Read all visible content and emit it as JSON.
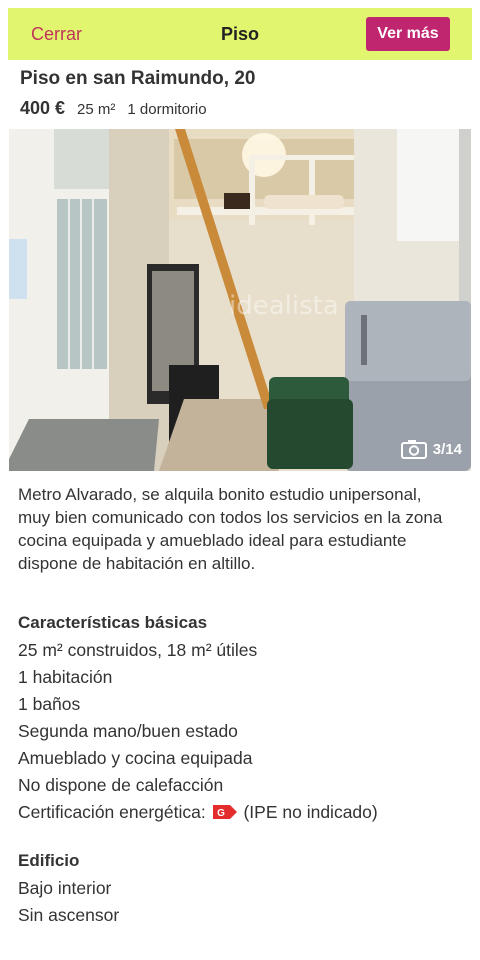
{
  "nav": {
    "close_label": "Cerrar",
    "title": "Piso",
    "more_label": "Ver más"
  },
  "listing": {
    "title": "Piso en san Raimundo, 20",
    "price": "400 €",
    "area": "25 m²",
    "bedrooms": "1 dormitorio"
  },
  "photo": {
    "watermark": "idealista",
    "counter": "3/14",
    "icon": "camera-icon"
  },
  "description": "Metro Alvarado, se alquila bonito estudio unipersonal, muy bien comunicado con todos los servicios en la zona cocina equipada y amueblado ideal para estudiante dispone de habitación en altillo.",
  "basic": {
    "title": "Características básicas",
    "items": [
      "25 m² construidos, 18 m² útiles",
      "1 habitación",
      "1 baños",
      "Segunda mano/buen estado",
      "Amueblado y cocina equipada",
      "No dispone de calefacción"
    ],
    "energy_label": "Certificación energética:",
    "energy_rating": "G",
    "energy_note": "(IPE no indicado)"
  },
  "building": {
    "title": "Edificio",
    "items": [
      "Bajo interior",
      "Sin ascensor"
    ]
  },
  "colors": {
    "navbar_bg": "#e1f56e",
    "accent": "#c0256f",
    "energy_g": "#e32d2d"
  }
}
